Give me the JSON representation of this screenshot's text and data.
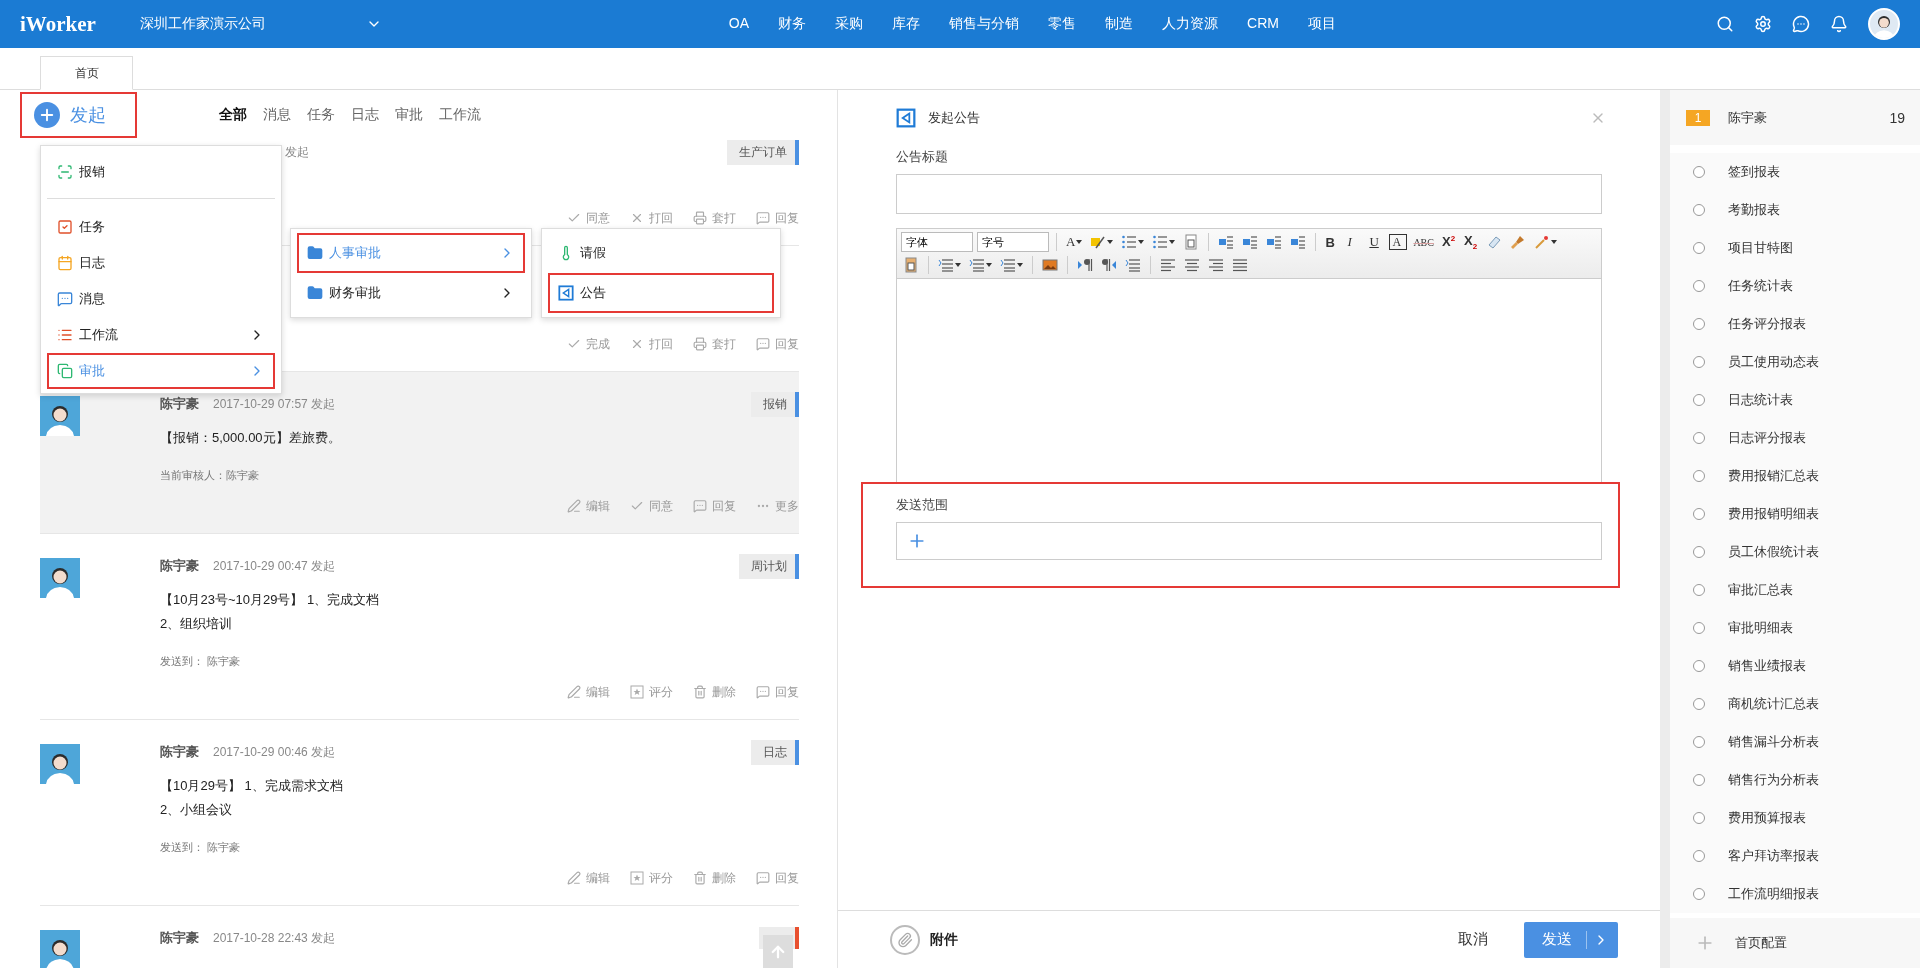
{
  "app": {
    "logo": "iWorker",
    "company": "深圳工作家演示公司"
  },
  "nav": [
    "OA",
    "财务",
    "采购",
    "库存",
    "销售与分销",
    "零售",
    "制造",
    "人力资源",
    "CRM",
    "项目"
  ],
  "tabs": [
    {
      "label": "首页",
      "selected": true
    }
  ],
  "launch_button": {
    "label": "发起",
    "highlighted": true
  },
  "filters": [
    {
      "label": "全部",
      "selected": true
    },
    {
      "label": "消息",
      "selected": false
    },
    {
      "label": "任务",
      "selected": false
    },
    {
      "label": "日志",
      "selected": false
    },
    {
      "label": "审批",
      "selected": false
    },
    {
      "label": "工作流",
      "selected": false
    }
  ],
  "feed": [
    {
      "kind": "partial",
      "meta": "发起",
      "tag": "生产订单",
      "color": "#4a90e2",
      "hovered": false,
      "actions": [
        {
          "kind": "agree",
          "label": "同意"
        },
        {
          "kind": "reject",
          "label": "打回"
        },
        {
          "kind": "print",
          "label": "套打"
        },
        {
          "kind": "reply",
          "label": "回复"
        }
      ]
    },
    {
      "kind": "partial",
      "hovered": false,
      "actions": [
        {
          "kind": "agree",
          "label": "完成"
        },
        {
          "kind": "reject",
          "label": "打回"
        },
        {
          "kind": "print",
          "label": "套打"
        },
        {
          "kind": "reply",
          "label": "回复"
        }
      ]
    },
    {
      "kind": "full",
      "name": "陈宇豪",
      "meta": "2017-10-29 07:57 发起",
      "tag": "报销",
      "color": "#4a90e2",
      "hovered": true,
      "lines": [
        "【报销：5,000.00元】差旅费。"
      ],
      "footer": "当前审核人：陈宇豪",
      "actions": [
        {
          "kind": "edit",
          "label": "编辑"
        },
        {
          "kind": "agree",
          "label": "同意"
        },
        {
          "kind": "reply",
          "label": "回复"
        },
        {
          "kind": "more",
          "label": "更多"
        }
      ]
    },
    {
      "kind": "full",
      "name": "陈宇豪",
      "meta": "2017-10-29 00:47 发起",
      "tag": "周计划",
      "color": "#4a90e2",
      "hovered": false,
      "lines": [
        "【10月23号~10月29号】 1、完成文档",
        "2、组织培训"
      ],
      "footer": "发送到： 陈宇豪",
      "actions": [
        {
          "kind": "edit",
          "label": "编辑"
        },
        {
          "kind": "rate",
          "label": "评分"
        },
        {
          "kind": "delete",
          "label": "删除"
        },
        {
          "kind": "reply",
          "label": "回复"
        }
      ]
    },
    {
      "kind": "full",
      "name": "陈宇豪",
      "meta": "2017-10-29 00:46 发起",
      "tag": "日志",
      "color": "#4a90e2",
      "hovered": false,
      "lines": [
        "【10月29号】 1、完成需求文档",
        "2、小组会议"
      ],
      "footer": "发送到： 陈宇豪",
      "actions": [
        {
          "kind": "edit",
          "label": "编辑"
        },
        {
          "kind": "rate",
          "label": "评分"
        },
        {
          "kind": "delete",
          "label": "删除"
        },
        {
          "kind": "reply",
          "label": "回复"
        }
      ]
    },
    {
      "kind": "full",
      "name": "陈宇豪",
      "meta": "2017-10-28 22:43 发起",
      "color": "#e8502f",
      "hovered": false
    }
  ],
  "launch_menu": [
    {
      "kind": "report",
      "label": "报销",
      "selected": false,
      "highlighted": false,
      "submenu": false
    },
    {
      "kind": "task",
      "label": "任务",
      "selected": false,
      "highlighted": false,
      "submenu": false
    },
    {
      "kind": "log",
      "label": "日志",
      "selected": false,
      "highlighted": false,
      "submenu": false
    },
    {
      "kind": "message",
      "label": "消息",
      "selected": false,
      "highlighted": false,
      "submenu": false
    },
    {
      "kind": "workflow",
      "label": "工作流",
      "selected": false,
      "highlighted": false,
      "submenu": true
    },
    {
      "kind": "approval",
      "label": "审批",
      "selected": true,
      "highlighted": true,
      "submenu": true
    }
  ],
  "approval_menu": [
    {
      "label": "人事审批",
      "selected": true,
      "highlighted": true
    },
    {
      "label": "财务审批",
      "selected": false,
      "highlighted": false
    }
  ],
  "hr_menu": [
    {
      "kind": "leave",
      "label": "请假",
      "highlighted": false
    },
    {
      "kind": "notice",
      "label": "公告",
      "highlighted": true
    }
  ],
  "compose": {
    "title": "发起公告",
    "title_label": "公告标题",
    "toolbar": [
      [
        {
          "kind": "select",
          "label": "字体"
        },
        {
          "kind": "select",
          "label": "字号"
        },
        {
          "kind": "sep"
        },
        {
          "kind": "letter",
          "label": "A",
          "dropdown": true
        },
        {
          "kind": "icon",
          "dropdown": true
        },
        {
          "kind": "icon",
          "dropdown": true
        },
        {
          "kind": "icon",
          "dropdown": true
        },
        {
          "kind": "icon",
          "dropdown": false
        },
        {
          "kind": "sep"
        },
        {
          "kind": "icon",
          "dropdown": false
        },
        {
          "kind": "icon",
          "dropdown": false
        },
        {
          "kind": "icon",
          "dropdown": false
        },
        {
          "kind": "icon",
          "dropdown": false
        },
        {
          "kind": "sep"
        },
        {
          "kind": "letter",
          "label": "B",
          "dropdown": false
        },
        {
          "kind": "letter",
          "label": "I",
          "dropdown": false
        },
        {
          "kind": "letter",
          "label": "U",
          "dropdown": false
        },
        {
          "kind": "letter",
          "label": "A",
          "dropdown": false
        },
        {
          "kind": "letter",
          "label": "ABC",
          "dropdown": false
        },
        {
          "kind": "letter",
          "label": "X$^{2}$",
          "dropdown": false
        },
        {
          "kind": "letter",
          "label": "X$_{2}$",
          "dropdown": false
        },
        {
          "kind": "icon",
          "dropdown": false
        },
        {
          "kind": "icon",
          "dropdown": false
        },
        {
          "kind": "icon",
          "dropdown": true
        }
      ],
      [
        {
          "kind": "icon",
          "dropdown": false
        },
        {
          "kind": "sep"
        },
        {
          "kind": "icon",
          "dropdown": true
        },
        {
          "kind": "icon",
          "dropdown": true
        },
        {
          "kind": "icon",
          "dropdown": true
        },
        {
          "kind": "sep"
        },
        {
          "kind": "icon",
          "dropdown": false
        },
        {
          "kind": "sep"
        },
        {
          "kind": "icon",
          "dropdown": false
        },
        {
          "kind": "icon",
          "dropdown": false
        },
        {
          "kind": "icon",
          "dropdown": false
        },
        {
          "kind": "sep"
        },
        {
          "kind": "icon",
          "dropdown": false
        },
        {
          "kind": "icon",
          "dropdown": false
        },
        {
          "kind": "icon",
          "dropdown": false
        },
        {
          "kind": "icon",
          "dropdown": false
        }
      ]
    ],
    "scope_label": "发送范围",
    "scope_highlighted": true,
    "attach": "附件",
    "cancel": "取消",
    "send": "发送"
  },
  "reports": {
    "rank": "1",
    "name": "陈宇豪",
    "count": "19",
    "items": [
      {
        "label": "签到报表",
        "selected": false
      },
      {
        "label": "考勤报表",
        "selected": false
      },
      {
        "label": "项目甘特图",
        "selected": false
      },
      {
        "label": "任务统计表",
        "selected": false
      },
      {
        "label": "任务评分报表",
        "selected": false
      },
      {
        "label": "员工使用动态表",
        "selected": false
      },
      {
        "label": "日志统计表",
        "selected": false
      },
      {
        "label": "日志评分报表",
        "selected": false
      },
      {
        "label": "费用报销汇总表",
        "selected": false
      },
      {
        "label": "费用报销明细表",
        "selected": false
      },
      {
        "label": "员工休假统计表",
        "selected": false
      },
      {
        "label": "审批汇总表",
        "selected": false
      },
      {
        "label": "审批明细表",
        "selected": false
      },
      {
        "label": "销售业绩报表",
        "selected": false
      },
      {
        "label": "商机统计汇总表",
        "selected": false
      },
      {
        "label": "销售漏斗分析表",
        "selected": false
      },
      {
        "label": "销售行为分析表",
        "selected": false
      },
      {
        "label": "费用预算报表",
        "selected": false
      },
      {
        "label": "客户拜访率报表",
        "selected": false
      },
      {
        "label": "工作流明细报表",
        "selected": false
      }
    ],
    "config": "首页配置"
  }
}
